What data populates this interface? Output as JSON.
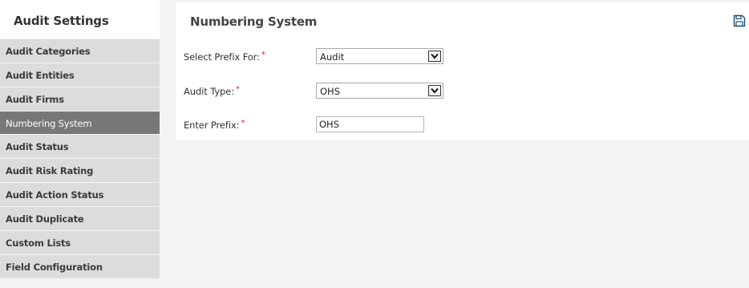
{
  "sidebar": {
    "title": "Audit Settings",
    "items": [
      {
        "label": "Audit Categories",
        "active": false
      },
      {
        "label": "Audit Entities",
        "active": false
      },
      {
        "label": "Audit Firms",
        "active": false
      },
      {
        "label": "Numbering System",
        "active": true
      },
      {
        "label": "Audit Status",
        "active": false
      },
      {
        "label": "Audit Risk Rating",
        "active": false
      },
      {
        "label": "Audit Action Status",
        "active": false
      },
      {
        "label": "Audit Duplicate",
        "active": false
      },
      {
        "label": "Custom Lists",
        "active": false
      },
      {
        "label": "Field Configuration",
        "active": false
      }
    ]
  },
  "main": {
    "title": "Numbering System",
    "save_icon": "save-icon",
    "required_marker": "*",
    "fields": {
      "prefix_for": {
        "label": "Select Prefix For:",
        "value": "Audit"
      },
      "audit_type": {
        "label": "Audit Type:",
        "value": "OHS"
      },
      "enter_prefix": {
        "label": "Enter Prefix:",
        "value": "OHS"
      }
    }
  },
  "colors": {
    "page_background": "#f3f3f3",
    "sidebar_item": "#dcdcdc",
    "sidebar_active": "#777777",
    "required": "#e02020"
  }
}
